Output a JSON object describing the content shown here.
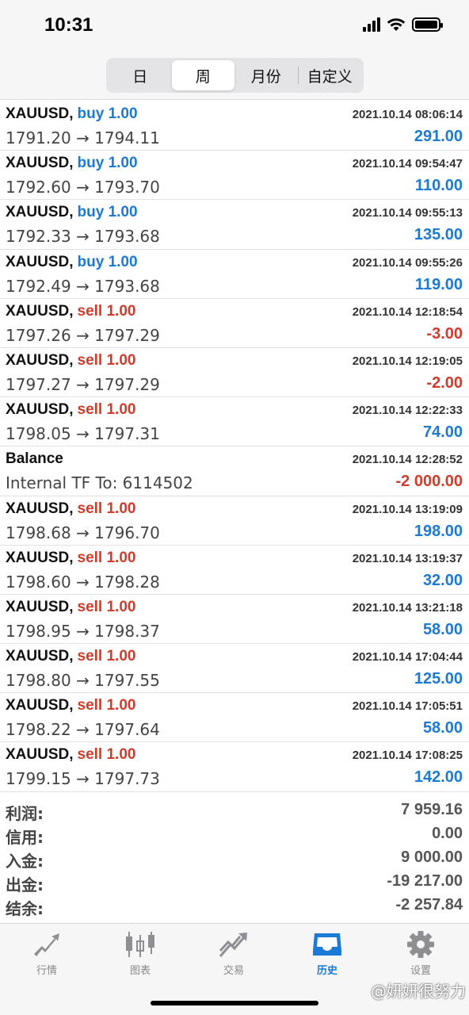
{
  "status_bar": {
    "time": "10:31"
  },
  "tabs": {
    "items": [
      "日",
      "周",
      "月份",
      "自定义"
    ],
    "active_index": 1
  },
  "trades": [
    {
      "symbol": "XAUUSD,",
      "side": "buy",
      "side_text": "buy 1.00",
      "time": "2021.10.14 08:06:14",
      "prices": "1791.20 → 1794.11",
      "profit": "291.00"
    },
    {
      "symbol": "XAUUSD,",
      "side": "buy",
      "side_text": "buy 1.00",
      "time": "2021.10.14 09:54:47",
      "prices": "1792.60 → 1793.70",
      "profit": "110.00"
    },
    {
      "symbol": "XAUUSD,",
      "side": "buy",
      "side_text": "buy 1.00",
      "time": "2021.10.14 09:55:13",
      "prices": "1792.33 → 1793.68",
      "profit": "135.00"
    },
    {
      "symbol": "XAUUSD,",
      "side": "buy",
      "side_text": "buy 1.00",
      "time": "2021.10.14 09:55:26",
      "prices": "1792.49 → 1793.68",
      "profit": "119.00"
    },
    {
      "symbol": "XAUUSD,",
      "side": "sell",
      "side_text": "sell 1.00",
      "time": "2021.10.14 12:18:54",
      "prices": "1797.26 → 1797.29",
      "profit": "-3.00"
    },
    {
      "symbol": "XAUUSD,",
      "side": "sell",
      "side_text": "sell 1.00",
      "time": "2021.10.14 12:19:05",
      "prices": "1797.27 → 1797.29",
      "profit": "-2.00"
    },
    {
      "symbol": "XAUUSD,",
      "side": "sell",
      "side_text": "sell 1.00",
      "time": "2021.10.14 12:22:33",
      "prices": "1798.05 → 1797.31",
      "profit": "74.00"
    },
    {
      "symbol": "Balance",
      "side": "none",
      "side_text": "",
      "time": "2021.10.14 12:28:52",
      "prices": "Internal TF To: 6114502",
      "profit": "-2 000.00"
    },
    {
      "symbol": "XAUUSD,",
      "side": "sell",
      "side_text": "sell 1.00",
      "time": "2021.10.14 13:19:09",
      "prices": "1798.68 → 1796.70",
      "profit": "198.00"
    },
    {
      "symbol": "XAUUSD,",
      "side": "sell",
      "side_text": "sell 1.00",
      "time": "2021.10.14 13:19:37",
      "prices": "1798.60 → 1798.28",
      "profit": "32.00"
    },
    {
      "symbol": "XAUUSD,",
      "side": "sell",
      "side_text": "sell 1.00",
      "time": "2021.10.14 13:21:18",
      "prices": "1798.95 → 1798.37",
      "profit": "58.00"
    },
    {
      "symbol": "XAUUSD,",
      "side": "sell",
      "side_text": "sell 1.00",
      "time": "2021.10.14 17:04:44",
      "prices": "1798.80 → 1797.55",
      "profit": "125.00"
    },
    {
      "symbol": "XAUUSD,",
      "side": "sell",
      "side_text": "sell 1.00",
      "time": "2021.10.14 17:05:51",
      "prices": "1798.22 → 1797.64",
      "profit": "58.00"
    },
    {
      "symbol": "XAUUSD,",
      "side": "sell",
      "side_text": "sell 1.00",
      "time": "2021.10.14 17:08:25",
      "prices": "1799.15 → 1797.73",
      "profit": "142.00"
    }
  ],
  "summary": [
    {
      "label": "利润:",
      "value": "7 959.16"
    },
    {
      "label": "信用:",
      "value": "0.00"
    },
    {
      "label": "入金:",
      "value": "9 000.00"
    },
    {
      "label": "出金:",
      "value": "-19 217.00"
    },
    {
      "label": "结余:",
      "value": "-2 257.84"
    }
  ],
  "tabbar": [
    {
      "label": "行情",
      "icon": "quotes-arrow-icon"
    },
    {
      "label": "图表",
      "icon": "candlestick-chart-icon"
    },
    {
      "label": "交易",
      "icon": "trade-trend-icon"
    },
    {
      "label": "历史",
      "icon": "history-inbox-icon"
    },
    {
      "label": "设置",
      "icon": "gear-icon"
    }
  ],
  "tabbar_active": 3,
  "watermark": "@妍妍很努力",
  "colors": {
    "buy": "#1a7ad6",
    "sell": "#d23a2a",
    "positive": "#1a7ad6",
    "negative": "#d23a2a"
  }
}
